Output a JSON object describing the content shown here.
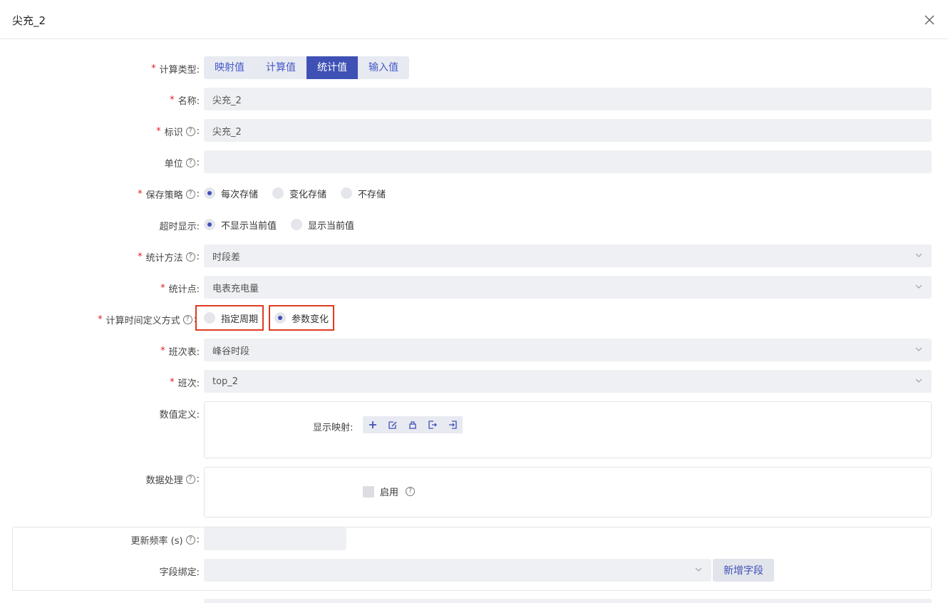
{
  "dialog": {
    "title": "尖充_2"
  },
  "calc_type": {
    "label": "计算类型:",
    "options": [
      "映射值",
      "计算值",
      "统计值",
      "输入值"
    ],
    "selected": "统计值"
  },
  "name": {
    "label": "名称:",
    "value": "尖充_2"
  },
  "identifier": {
    "label": "标识",
    "colon": ":",
    "value": "尖充_2"
  },
  "unit": {
    "label": "单位",
    "colon": ":",
    "value": ""
  },
  "save_strategy": {
    "label": "保存策略",
    "colon": ":",
    "options": [
      "每次存储",
      "变化存储",
      "不存储"
    ],
    "selected": "每次存储"
  },
  "timeout_display": {
    "label": "超时显示:",
    "options": [
      "不显示当前值",
      "显示当前值"
    ],
    "selected": "不显示当前值"
  },
  "stat_method": {
    "label": "统计方法 ",
    "colon": ":",
    "value": "时段差"
  },
  "stat_point": {
    "label": "统计点:",
    "value": "电表充电量"
  },
  "time_def": {
    "label": "计算时间定义方式",
    "colon": ":",
    "options": [
      "指定周期",
      "参数变化"
    ],
    "selected": "参数变化"
  },
  "shift_table": {
    "label": "班次表:",
    "value": "峰谷时段"
  },
  "shift": {
    "label": "班次:",
    "value": "top_2"
  },
  "value_def": {
    "label": "数值定义:",
    "mapping_label": "显示映射:"
  },
  "data_processing": {
    "label": "数据处理",
    "colon": ":",
    "enable_label": "启用"
  },
  "update_freq": {
    "label": "更新频率 (s)",
    "colon": ":",
    "value": ""
  },
  "field_binding": {
    "label": "字段绑定:",
    "value": "",
    "add_button": "新增字段"
  },
  "colors": {
    "accent": "#3f51b5",
    "highlight": "#e03b1f",
    "required": "#e02020"
  }
}
